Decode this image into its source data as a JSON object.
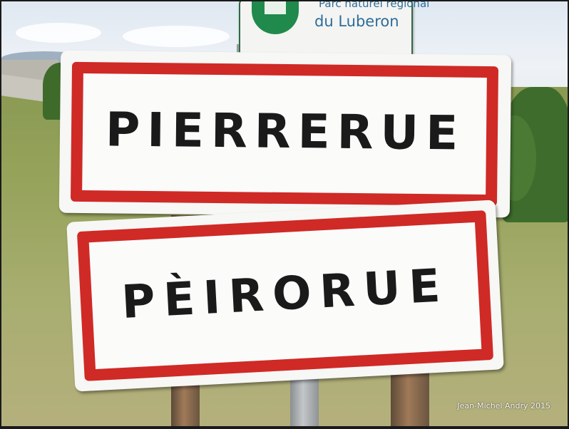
{
  "sign_top": {
    "line1": "Parc naturel régional",
    "line2": "du Luberon"
  },
  "sign_main": {
    "french_name": "PIERRERUE",
    "occitan_name": "PÈIRORUE"
  },
  "credit": "Jean-Michel Andry 2015",
  "colors": {
    "sign_border": "#cf2a26",
    "sign_background": "#fbfbfa",
    "sign_text": "#1a1a1a",
    "parc_text": "#2d6d9a",
    "parc_logo": "#1f8a4c"
  }
}
